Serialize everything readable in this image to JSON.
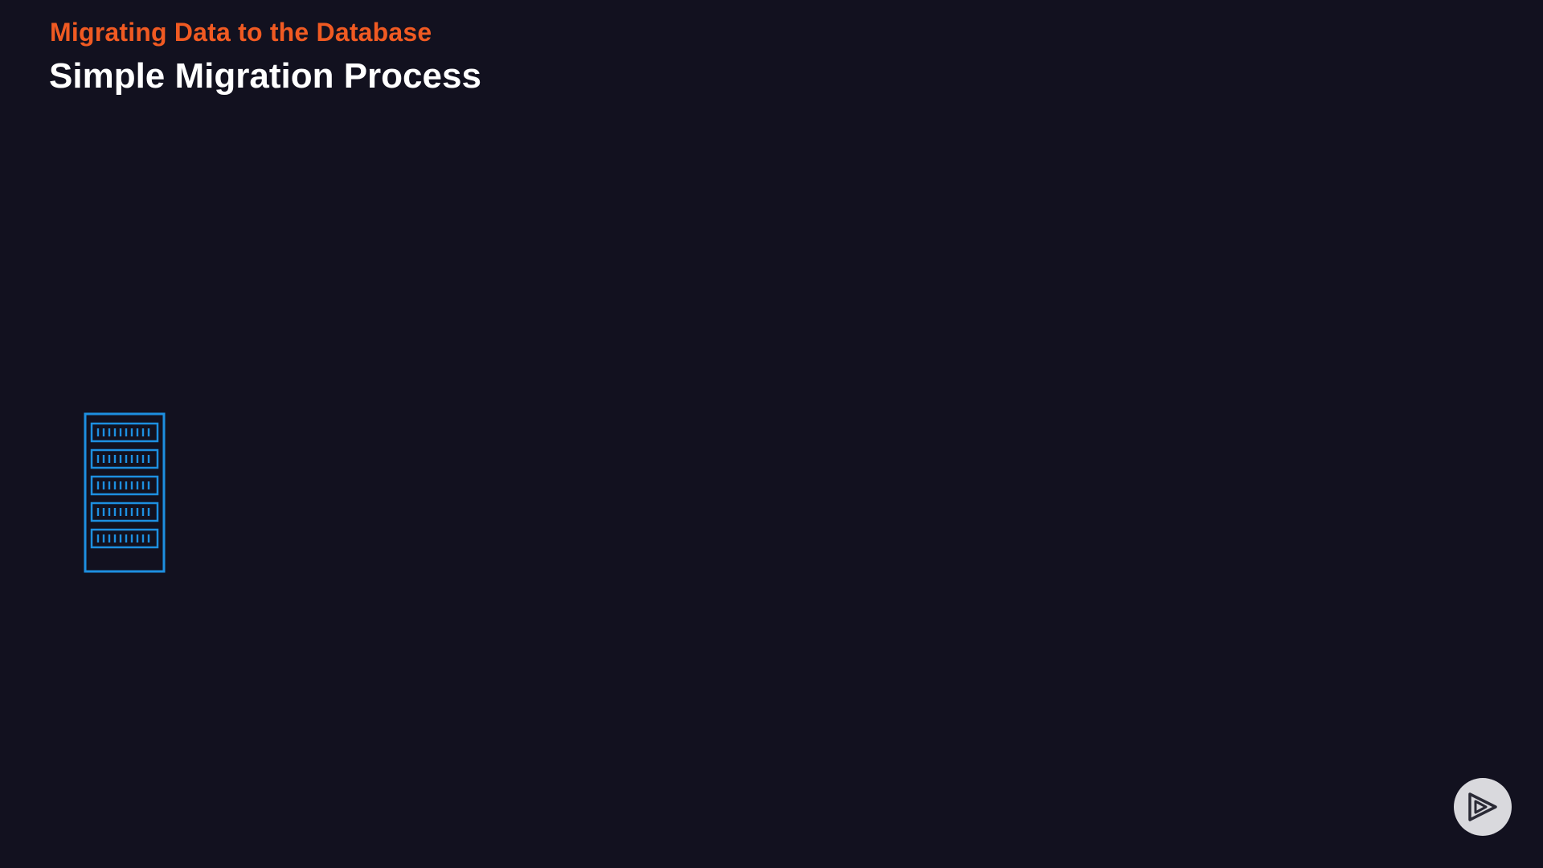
{
  "header": {
    "subtitle": "Migrating Data to the Database",
    "title": "Simple Migration Process"
  },
  "diagram": {
    "nodes": [
      {
        "id": "server",
        "icon": "server-rack-icon"
      }
    ]
  },
  "controls": {
    "play_icon": "play-logo-icon"
  },
  "colors": {
    "background": "#12111f",
    "subtitle": "#f05a22",
    "title": "#ffffff",
    "server": "#1d8fe0",
    "play_button_bg": "#d9d9dd",
    "play_button_fg": "#2a2a35"
  }
}
